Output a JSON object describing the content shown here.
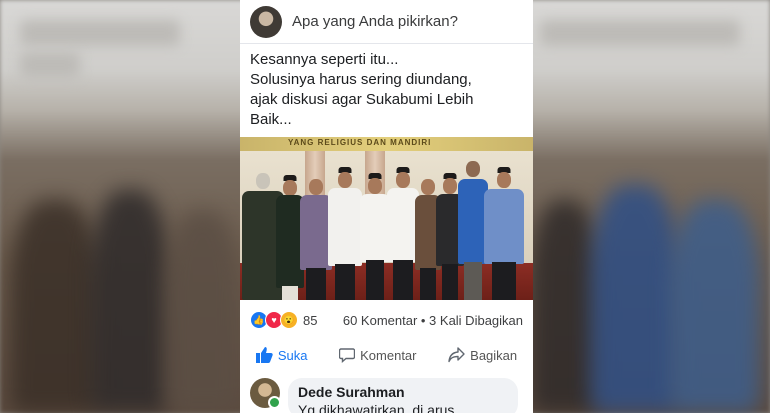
{
  "composer": {
    "placeholder": "Apa yang Anda pikirkan?"
  },
  "post": {
    "lines": [
      "Kesannya seperti itu...",
      "Solusinya harus sering diundang,",
      "ajak diskusi agar Sukabumi Lebih",
      "Baik..."
    ],
    "photo_banner": "YANG RELIGIUS DAN MANDIRI"
  },
  "reactions": {
    "icons": [
      "like-icon",
      "love-icon",
      "wow-icon"
    ],
    "count": "85",
    "summary": "60 Komentar • 3 Kali Dibagikan"
  },
  "actions": {
    "like": "Suka",
    "comment": "Komentar",
    "share": "Bagikan"
  },
  "comment": {
    "author": "Dede Surahman",
    "text": "Yg dikhawatirkan, di arus..."
  },
  "colors": {
    "brand": "#1877f2",
    "love": "#f02849",
    "wow": "#f7b125",
    "online": "#31a24c"
  }
}
